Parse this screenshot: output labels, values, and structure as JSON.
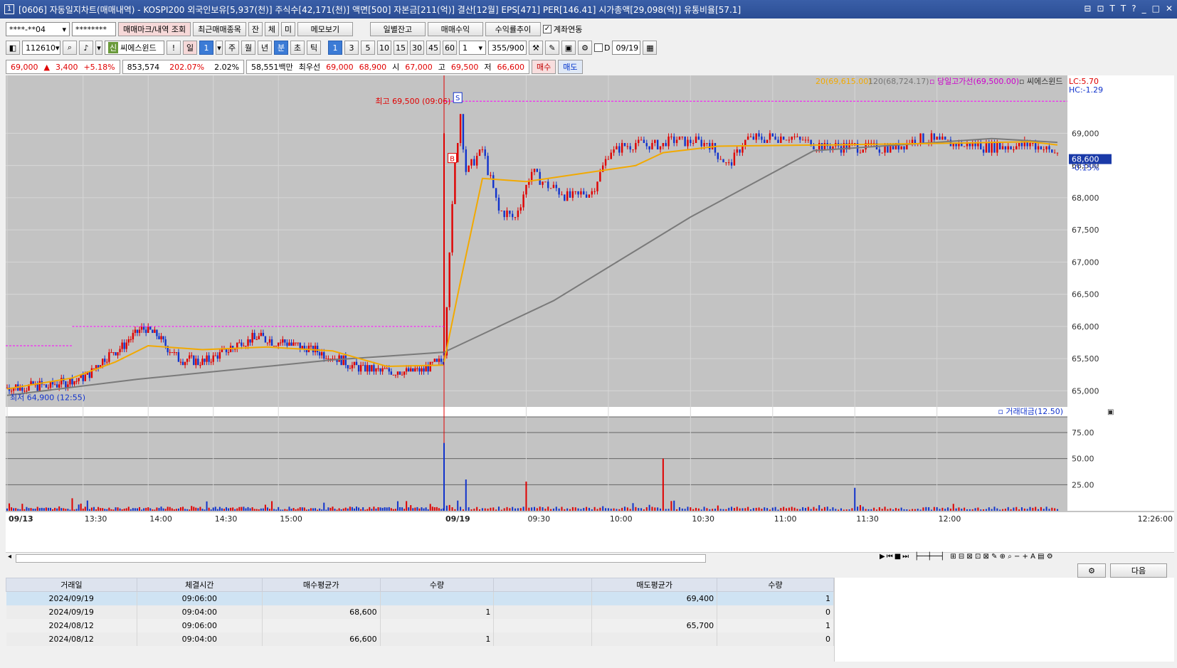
{
  "window": {
    "app_code": "1",
    "title": "[0606] 자동일지차트(매매내역) - KOSPI200 외국인보유[5,937(천)] 주식수[42,171(천)] 액면[500] 자본금[211(억)] 결산[12월] EPS[471] PER[146.41] 시가총액[29,098(억)] 유통비율[57.1]",
    "controls": [
      "⊟",
      "⊡",
      "T",
      "T",
      "?",
      "_",
      "□",
      "✕"
    ]
  },
  "toolbar1": {
    "account": "****-**04",
    "password": "********",
    "btn_trade_mark": "매매마크/내역 조회",
    "btn_recent": "최근매매종목",
    "tab_jan": "잔",
    "tab_che": "체",
    "tab_mi": "미",
    "btn_memo": "메모보기",
    "btn_daily_balance": "일별잔고",
    "btn_trade_profit": "매매수익",
    "btn_return_trend": "수익률추이",
    "chk_account_link": "계좌연동"
  },
  "toolbar2": {
    "code": "112610",
    "stock_name": "씨에스윈드",
    "sin_badge": "신",
    "excl": "!",
    "period_day": "일",
    "period_num": "1",
    "periods": [
      "주",
      "월",
      "년",
      "분",
      "초",
      "틱"
    ],
    "active_period": "분",
    "minute_options": [
      "1",
      "3",
      "5",
      "10",
      "15",
      "30",
      "45",
      "60"
    ],
    "active_minute": "1",
    "count_val": "1",
    "bars_shown": "355",
    "bars_total": "/900",
    "d_label": "D",
    "date": "09/19"
  },
  "quote": {
    "price": "69,000",
    "change": "▲",
    "change_amt": "3,400",
    "change_pct": "+5.18%",
    "volume": "853,574",
    "vol_ratio": "202.07%",
    "turnover": "2.02%",
    "amount": "58,551백만",
    "best_label": "최우선",
    "ask": "69,000",
    "bid": "68,900",
    "open_label": "시",
    "open": "67,000",
    "high_label": "고",
    "high": "69,500",
    "low_label": "저",
    "low": "66,600",
    "btn_buy": "매수",
    "btn_sell": "매도"
  },
  "chart_data": {
    "type": "candlestick",
    "stock_name": "씨에스윈드",
    "period": "1분",
    "legend": {
      "ma20": "20(69,615.00)",
      "ma120": "120(68,724.17)",
      "today_high_line": "당일고가선(69,500.00)",
      "stock": "씨에스윈드",
      "lc": "LC:5.70",
      "hc": "HC:-1.29"
    },
    "current_price": "68,600",
    "current_change": "-0.15%",
    "annotation_high": "최고 69,500 (09:06)",
    "annotation_low": "최저 64,900 (12:55)",
    "marker_sell": "S",
    "marker_buy": "B",
    "yaxis_price": [
      "69,000",
      "68,500",
      "68,000",
      "67,500",
      "67,000",
      "66,500",
      "66,000",
      "65,500",
      "65,000"
    ],
    "ylim_price": [
      64750,
      69900
    ],
    "volume_panel_label": "거래대금(12.50)",
    "yaxis_volume": [
      "75.00",
      "50.00",
      "25.00"
    ],
    "ylim_volume": [
      0,
      90
    ],
    "xaxis": [
      "09/13",
      "13:30",
      "14:00",
      "14:30",
      "15:00",
      "09/19",
      "09:30",
      "10:00",
      "10:30",
      "11:00",
      "11:30",
      "12:00"
    ],
    "xaxis_last": "12:26:00",
    "session1_path": [
      [
        0,
        65050
      ],
      [
        20,
        65080
      ],
      [
        35,
        65200
      ],
      [
        45,
        65500
      ],
      [
        55,
        65760
      ],
      [
        62,
        65980
      ],
      [
        70,
        65850
      ],
      [
        78,
        65520
      ],
      [
        90,
        65440
      ],
      [
        100,
        65600
      ],
      [
        108,
        65760
      ],
      [
        116,
        65820
      ],
      [
        128,
        65750
      ],
      [
        140,
        65650
      ],
      [
        152,
        65520
      ],
      [
        160,
        65380
      ],
      [
        170,
        65300
      ],
      [
        180,
        65320
      ],
      [
        190,
        65300
      ],
      [
        196,
        65400
      ],
      [
        201,
        65450
      ]
    ],
    "session2_path": [
      [
        0,
        65600
      ],
      [
        2,
        67200
      ],
      [
        4,
        68500
      ],
      [
        6,
        69300
      ],
      [
        8,
        68400
      ],
      [
        14,
        68750
      ],
      [
        20,
        67800
      ],
      [
        26,
        67700
      ],
      [
        32,
        68400
      ],
      [
        38,
        68200
      ],
      [
        46,
        68000
      ],
      [
        54,
        68100
      ],
      [
        60,
        68700
      ],
      [
        70,
        68850
      ],
      [
        78,
        68800
      ],
      [
        84,
        68900
      ],
      [
        96,
        68850
      ],
      [
        104,
        68500
      ],
      [
        110,
        68900
      ],
      [
        118,
        68920
      ],
      [
        124,
        68950
      ],
      [
        132,
        68880
      ],
      [
        140,
        68780
      ],
      [
        150,
        68800
      ],
      [
        164,
        68780
      ],
      [
        174,
        68930
      ],
      [
        184,
        68850
      ],
      [
        196,
        68800
      ],
      [
        206,
        68800
      ],
      [
        214,
        68850
      ],
      [
        224,
        68700
      ]
    ],
    "ma20_s1": [
      [
        0,
        65030
      ],
      [
        30,
        65200
      ],
      [
        50,
        65450
      ],
      [
        65,
        65700
      ],
      [
        90,
        65640
      ],
      [
        120,
        65680
      ],
      [
        150,
        65620
      ],
      [
        175,
        65380
      ],
      [
        201,
        65400
      ]
    ],
    "ma120_s1": [
      [
        0,
        64930
      ],
      [
        60,
        65180
      ],
      [
        150,
        65480
      ],
      [
        201,
        65600
      ]
    ],
    "ma20_s2": [
      [
        0,
        65450
      ],
      [
        6,
        66700
      ],
      [
        14,
        68300
      ],
      [
        30,
        68250
      ],
      [
        70,
        68500
      ],
      [
        80,
        68700
      ],
      [
        100,
        68800
      ],
      [
        140,
        68820
      ],
      [
        190,
        68850
      ],
      [
        214,
        68870
      ],
      [
        224,
        68820
      ]
    ],
    "ma120_s2": [
      [
        0,
        65600
      ],
      [
        40,
        66400
      ],
      [
        90,
        67700
      ],
      [
        135,
        68730
      ],
      [
        200,
        68920
      ],
      [
        224,
        68860
      ]
    ],
    "volume_peaks_s2": [
      [
        0,
        65
      ],
      [
        2,
        45
      ],
      [
        5,
        60
      ],
      [
        8,
        30
      ],
      [
        30,
        28
      ],
      [
        80,
        50
      ],
      [
        150,
        22
      ]
    ]
  },
  "bottom_buttons": {
    "settings_icon": "gear-icon",
    "next": "다음"
  },
  "trades": {
    "columns": [
      "거래일",
      "체결시간",
      "매수평균가",
      "수량",
      "",
      "매도평균가",
      "수량"
    ],
    "rows": [
      [
        "2024/09/19",
        "09:06:00",
        "",
        "",
        "",
        "69,400",
        "1"
      ],
      [
        "2024/09/19",
        "09:04:00",
        "68,600",
        "1",
        "",
        "",
        "0"
      ],
      [
        "2024/08/12",
        "09:06:00",
        "",
        "",
        "",
        "65,700",
        "1"
      ],
      [
        "2024/08/12",
        "09:04:00",
        "66,600",
        "1",
        "",
        "",
        "0"
      ]
    ]
  },
  "colors": {
    "up": "#e00000",
    "down": "#1133cc",
    "ma20": "#f2a900",
    "ma120": "#7a7a7a",
    "chart_bg": "#c3c3c3",
    "high_line": "#ff00ff"
  }
}
